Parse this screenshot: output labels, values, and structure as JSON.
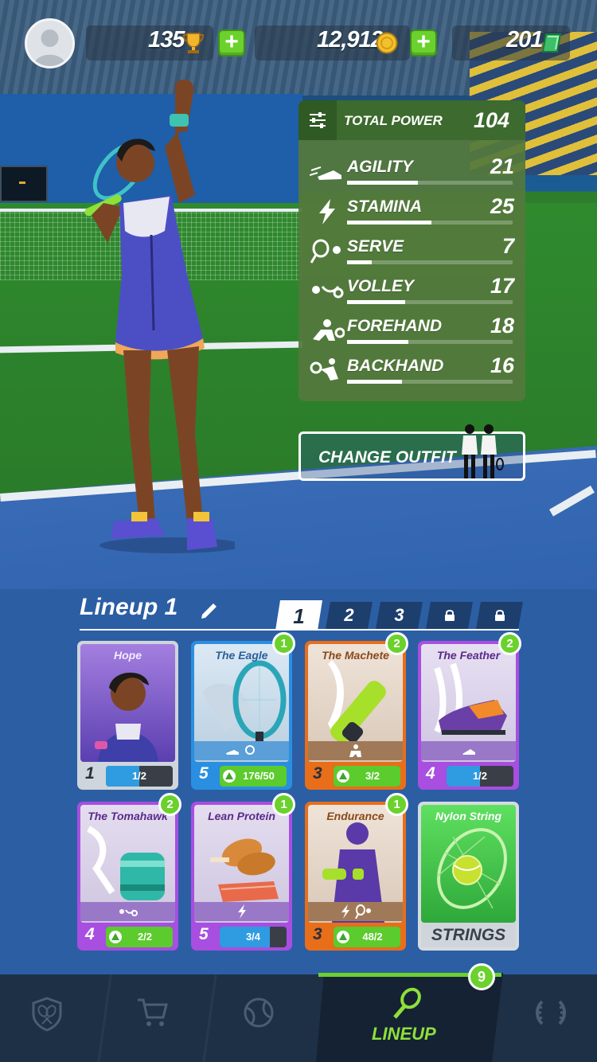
{
  "currency": {
    "trophies": "135",
    "coins": "12,912",
    "gems": "201",
    "plus_label": "+"
  },
  "stats": {
    "title": "TOTAL POWER",
    "total": "104",
    "items": [
      {
        "icon": "agility-icon",
        "name": "AGILITY",
        "value": "21",
        "fill": 0.43
      },
      {
        "icon": "stamina-icon",
        "name": "STAMINA",
        "value": "25",
        "fill": 0.51
      },
      {
        "icon": "serve-icon",
        "name": "SERVE",
        "value": "7",
        "fill": 0.15
      },
      {
        "icon": "volley-icon",
        "name": "VOLLEY",
        "value": "17",
        "fill": 0.35
      },
      {
        "icon": "forehand-icon",
        "name": "FOREHAND",
        "value": "18",
        "fill": 0.37
      },
      {
        "icon": "backhand-icon",
        "name": "BACKHAND",
        "value": "16",
        "fill": 0.33
      }
    ]
  },
  "outfit": {
    "label": "CHANGE OUTFIT"
  },
  "lineup": {
    "title": "Lineup 1",
    "tabs": [
      "1",
      "2",
      "3"
    ],
    "locked_tabs": 2
  },
  "cards": [
    {
      "title": "Hope",
      "level": "1",
      "progress": "1/2",
      "fill": 0.5,
      "badge": "",
      "kind": "character",
      "bar_color": "#2f9be0",
      "has_arrow": false
    },
    {
      "title": "The Eagle",
      "level": "5",
      "progress": "176/50",
      "fill": 1,
      "badge": "1",
      "kind": "racket",
      "bar_color": "#5ccb2d",
      "has_arrow": true
    },
    {
      "title": "The Machete",
      "level": "3",
      "progress": "3/2",
      "fill": 1,
      "badge": "2",
      "kind": "grip",
      "bar_color": "#5ccb2d",
      "has_arrow": true
    },
    {
      "title": "The Feather",
      "level": "4",
      "progress": "1/2",
      "fill": 0.5,
      "badge": "2",
      "kind": "shoe",
      "bar_color": "#2f9be0",
      "has_arrow": false
    },
    {
      "title": "The Tomahawk",
      "level": "4",
      "progress": "2/2",
      "fill": 1,
      "badge": "2",
      "kind": "wrist",
      "bar_color": "#5ccb2d",
      "has_arrow": true
    },
    {
      "title": "Lean Protein",
      "level": "5",
      "progress": "3/4",
      "fill": 0.75,
      "badge": "1",
      "kind": "food",
      "bar_color": "#2f9be0",
      "has_arrow": false
    },
    {
      "title": "Endurance",
      "level": "3",
      "progress": "48/2",
      "fill": 1,
      "badge": "1",
      "kind": "training",
      "bar_color": "#5ccb2d",
      "has_arrow": true
    },
    {
      "title": "Nylon String",
      "footer": "STRINGS",
      "badge": "",
      "kind": "strings"
    }
  ],
  "nav": {
    "active_label": "LINEUP",
    "badge": "9"
  },
  "colors": {
    "accent_green": "#6bd12d",
    "panel_blue": "#2c5ea4",
    "nav_dark": "#1e3046"
  }
}
